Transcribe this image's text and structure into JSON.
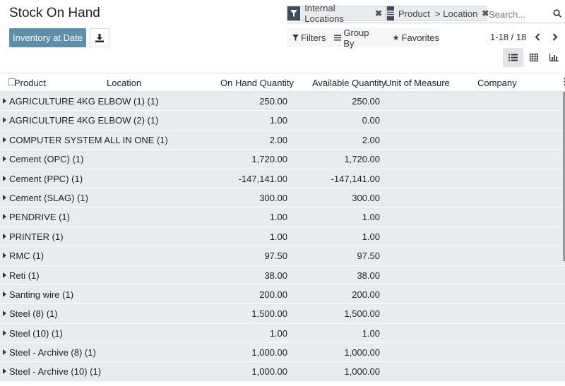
{
  "header": {
    "title": "Stock On Hand",
    "inventory_button": "Inventory at Date"
  },
  "search": {
    "facets": [
      {
        "icon": "filter-icon",
        "label": "Internal Locations"
      },
      {
        "icon": "group-by-icon",
        "label": "Product  > Location"
      }
    ],
    "placeholder": "Search..."
  },
  "filterbar": {
    "filters": "Filters",
    "group_by": "Group By",
    "favorites": "Favorites"
  },
  "pager": {
    "text": "1-18 / 18"
  },
  "table": {
    "columns": {
      "product": "Product",
      "location": "Location",
      "on_hand": "On Hand Quantity",
      "available": "Available Quantity",
      "uom": "Unit of Measure",
      "company": "Company"
    },
    "rows": [
      {
        "name": "AGRICULTURE 4KG ELBOW (1) (1)",
        "on_hand": "250.00",
        "available": "250.00"
      },
      {
        "name": "AGRICULTURE 4KG ELBOW (2) (1)",
        "on_hand": "1.00",
        "available": "0.00"
      },
      {
        "name": "COMPUTER SYSTEM ALL IN ONE (1)",
        "on_hand": "2.00",
        "available": "2.00"
      },
      {
        "name": "Cement (OPC) (1)",
        "on_hand": "1,720.00",
        "available": "1,720.00"
      },
      {
        "name": "Cement (PPC) (1)",
        "on_hand": "-147,141.00",
        "available": "-147,141.00"
      },
      {
        "name": "Cement (SLAG) (1)",
        "on_hand": "300.00",
        "available": "300.00"
      },
      {
        "name": "PENDRIVE (1)",
        "on_hand": "1.00",
        "available": "1.00"
      },
      {
        "name": "PRINTER (1)",
        "on_hand": "1.00",
        "available": "1.00"
      },
      {
        "name": "RMC (1)",
        "on_hand": "97.50",
        "available": "97.50"
      },
      {
        "name": "Reti (1)",
        "on_hand": "38.00",
        "available": "38.00"
      },
      {
        "name": "Santing wire (1)",
        "on_hand": "200.00",
        "available": "200.00"
      },
      {
        "name": "Steel (8) (1)",
        "on_hand": "1,500.00",
        "available": "1,500.00"
      },
      {
        "name": "Steel (10) (1)",
        "on_hand": "1.00",
        "available": "1.00"
      },
      {
        "name": "Steel - Archive (8) (1)",
        "on_hand": "1,000.00",
        "available": "1,000.00"
      },
      {
        "name": "Steel - Archive (10) (1)",
        "on_hand": "1,000.00",
        "available": "1,000.00"
      }
    ]
  }
}
